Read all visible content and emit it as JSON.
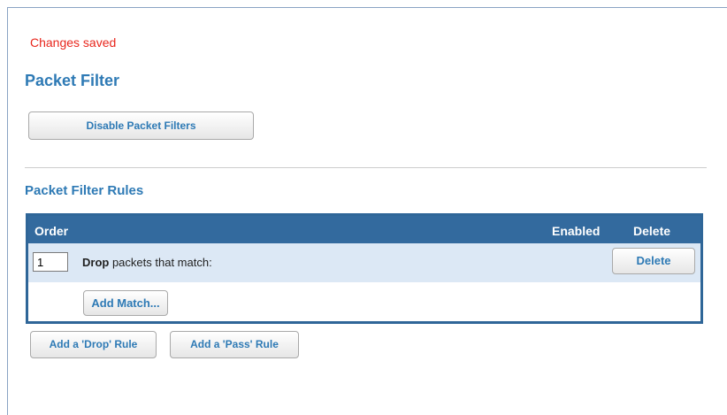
{
  "status": {
    "message": "Changes saved",
    "color": "#e8261c"
  },
  "page": {
    "title": "Packet Filter",
    "disable_button_label": "Disable Packet Filters"
  },
  "rules_section": {
    "title": "Packet Filter Rules",
    "columns": {
      "order": "Order",
      "enabled": "Enabled",
      "delete": "Delete"
    },
    "rules": [
      {
        "order_value": "1",
        "action": "Drop",
        "description": " packets that match:",
        "delete_label": "Delete",
        "add_match_label": "Add Match..."
      }
    ],
    "add_drop_rule_label": "Add a 'Drop' Rule",
    "add_pass_rule_label": "Add a 'Pass' Rule"
  },
  "colors": {
    "accent": "#2e7ab5",
    "header_bg": "#336a9e",
    "row_bg": "#dce8f5"
  }
}
